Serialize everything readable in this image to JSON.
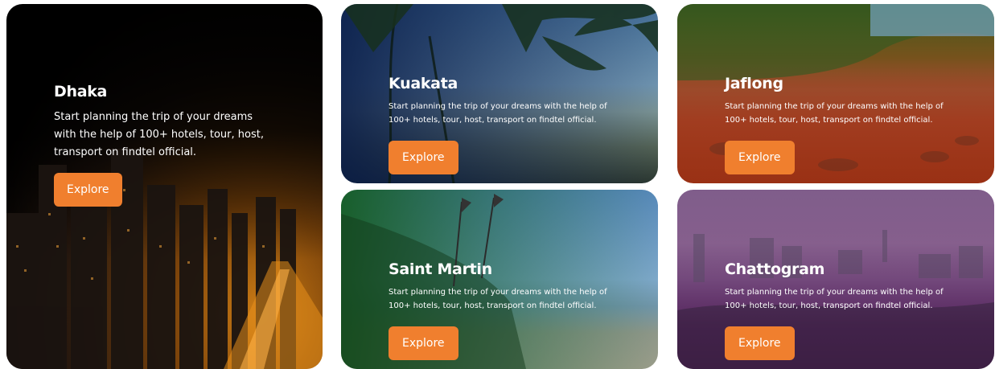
{
  "destinations": [
    {
      "name": "Dhaka",
      "description": "Start planning the trip of your dreams with the help of 100+ hotels, tour, host, transport on findtel official.",
      "button_label": "Explore"
    },
    {
      "name": "Kuakata",
      "description": "Start planning the trip of your dreams with the help of 100+ hotels, tour, host, transport on findtel official.",
      "button_label": "Explore"
    },
    {
      "name": "Jaflong",
      "description": "Start planning the trip of your dreams with the help of 100+ hotels, tour, host, transport on findtel official.",
      "button_label": "Explore"
    },
    {
      "name": "Saint Martin",
      "description": "Start planning the trip of your dreams with the help of 100+ hotels, tour, host, transport on findtel official.",
      "button_label": "Explore"
    },
    {
      "name": "Chattogram",
      "description": "Start planning the trip of your dreams with the help of 100+ hotels, tour, host, transport on findtel official.",
      "button_label": "Explore"
    }
  ],
  "colors": {
    "accent": "#f07f2e"
  }
}
